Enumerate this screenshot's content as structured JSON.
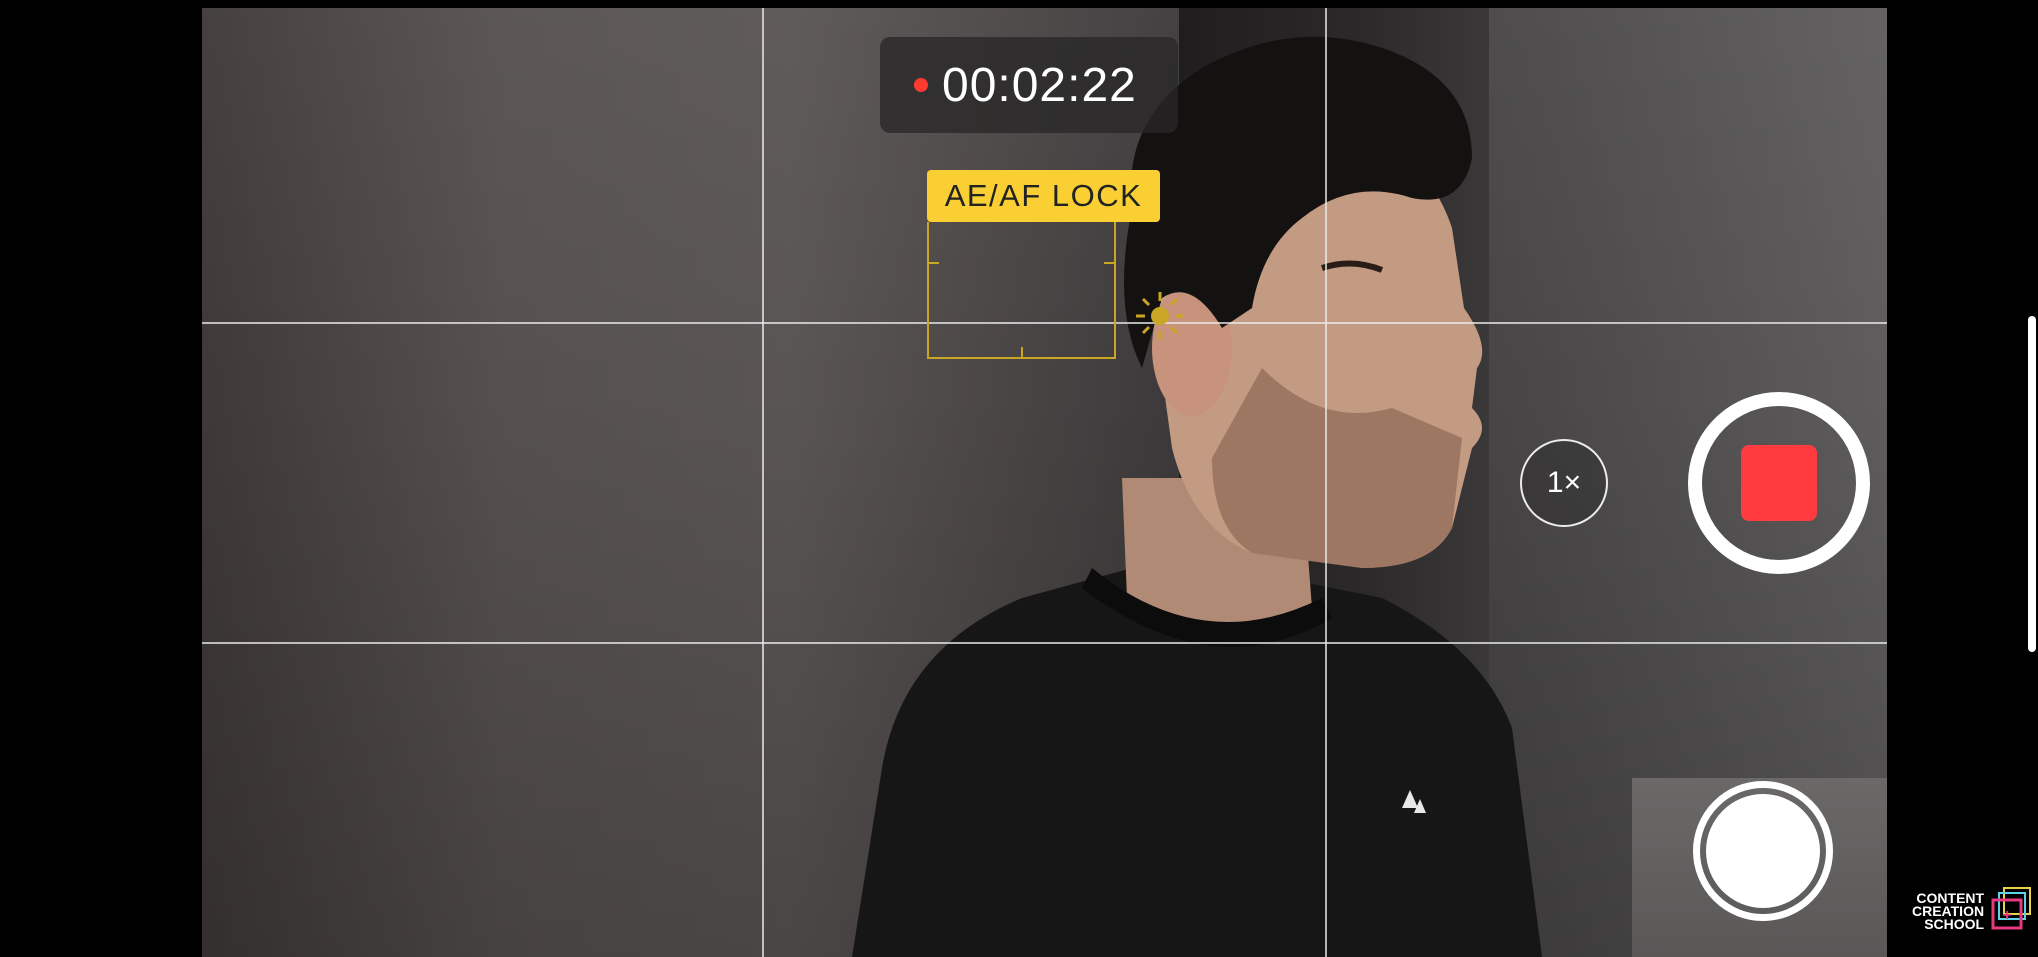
{
  "recording": {
    "timer": "00:02:22",
    "indicator_color": "#ff3b30"
  },
  "focus": {
    "lock_label": "AE/AF LOCK",
    "badge_color": "#f9cf33",
    "exposure_icon": "sun-icon"
  },
  "controls": {
    "zoom_label": "1×",
    "record_button_icon": "stop-square-icon",
    "record_color": "#ff3b3f",
    "shutter_icon": "shutter-circle-icon"
  },
  "watermark": {
    "line1": "CONTENT",
    "line2": "CREATION",
    "line3": "SCHOOL",
    "logo_icon": "plus-square-logo",
    "logo_color": "#e6397f"
  },
  "viewfinder": {
    "grid": true
  }
}
